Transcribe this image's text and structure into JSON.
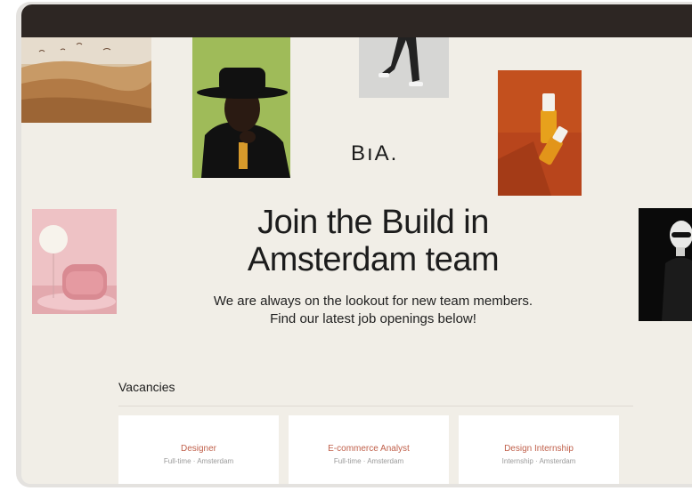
{
  "brand": {
    "logo": "BıA."
  },
  "hero": {
    "heading_line1": "Join the Build in",
    "heading_line2": "Amsterdam team",
    "intro_line1": "We are always on the lookout for new team members.",
    "intro_line2": "Find our latest job openings below!"
  },
  "vacancies": {
    "title": "Vacancies",
    "jobs": [
      {
        "title": "Designer",
        "meta": "Full-time · Amsterdam"
      },
      {
        "title": "E-commerce Analyst",
        "meta": "Full-time · Amsterdam"
      },
      {
        "title": "Design Internship",
        "meta": "Internship · Amsterdam"
      }
    ]
  },
  "colors": {
    "page_background": "#f1eee7",
    "top_bar": "#2d2623",
    "job_title": "#c0614c",
    "card": "#ffffff"
  }
}
